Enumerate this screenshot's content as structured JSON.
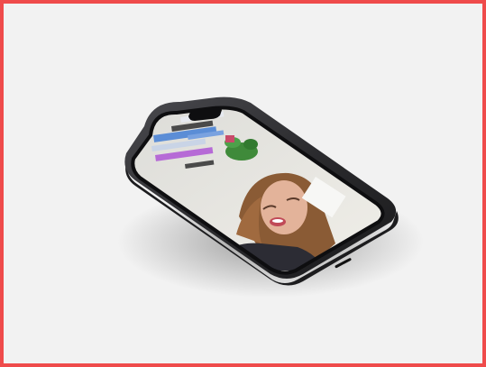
{
  "scene": {
    "subject": "smartphone-mockup",
    "frame_color": "#ef4b4b",
    "background_color": "#f2f2f2",
    "phone_body_color": "#2b2b2e",
    "screen_content": "video-call-woman-smiling",
    "shelf_colors": [
      "#5b8dd6",
      "#c9d4e6",
      "#b66ad6",
      "#4a4a4a",
      "#e7eaf0"
    ],
    "plant_color": "#3f8a3a",
    "hair_color": "#8a5b35",
    "skin_color": "#e3b39a",
    "lip_color": "#c04a57",
    "shirt_color": "#2c2c34"
  }
}
